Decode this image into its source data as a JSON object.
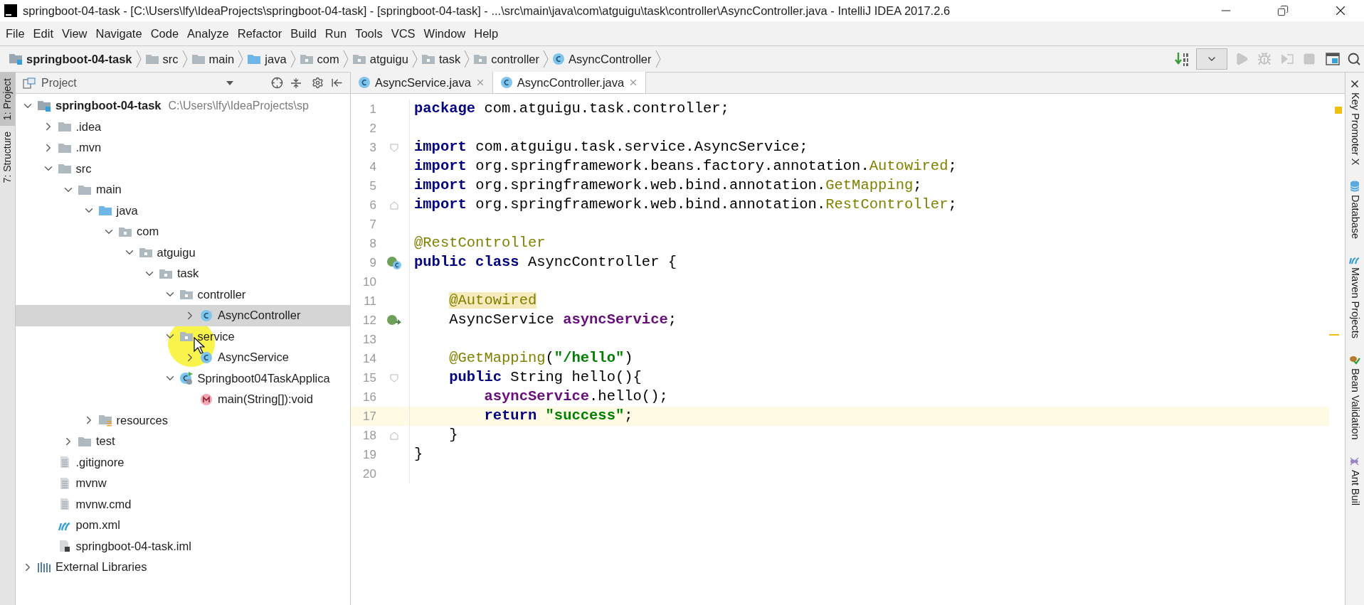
{
  "window": {
    "title": "springboot-04-task - [C:\\Users\\lfy\\IdeaProjects\\springboot-04-task] - [springboot-04-task] - ...\\src\\main\\java\\com\\atguigu\\task\\controller\\AsyncController.java - IntelliJ IDEA 2017.2.6"
  },
  "menu": [
    "File",
    "Edit",
    "View",
    "Navigate",
    "Code",
    "Analyze",
    "Refactor",
    "Build",
    "Run",
    "Tools",
    "VCS",
    "Window",
    "Help"
  ],
  "breadcrumbs": [
    {
      "label": "springboot-04-task",
      "kind": "module"
    },
    {
      "label": "src",
      "kind": "folder"
    },
    {
      "label": "main",
      "kind": "folder"
    },
    {
      "label": "java",
      "kind": "source-root"
    },
    {
      "label": "com",
      "kind": "package"
    },
    {
      "label": "atguigu",
      "kind": "package"
    },
    {
      "label": "task",
      "kind": "package"
    },
    {
      "label": "controller",
      "kind": "package"
    },
    {
      "label": "AsyncController",
      "kind": "class"
    }
  ],
  "left_tool_tabs": [
    {
      "label": "1: Project",
      "selected": true
    },
    {
      "label": "7: Structure",
      "selected": false
    }
  ],
  "project_panel": {
    "title": "Project"
  },
  "tree": [
    {
      "label": "springboot-04-task",
      "kind": "module",
      "path": "C:\\Users\\lfy\\IdeaProjects\\sp",
      "expanded": true,
      "selected": false,
      "children": [
        {
          "label": ".idea",
          "kind": "folder",
          "expanded": false,
          "selected": false
        },
        {
          "label": ".mvn",
          "kind": "folder",
          "expanded": false,
          "selected": false
        },
        {
          "label": "src",
          "kind": "folder",
          "expanded": true,
          "selected": false,
          "children": [
            {
              "label": "main",
              "kind": "folder",
              "expanded": true,
              "selected": false,
              "children": [
                {
                  "label": "java",
                  "kind": "source-root",
                  "expanded": true,
                  "selected": false,
                  "children": [
                    {
                      "label": "com",
                      "kind": "package",
                      "expanded": true,
                      "selected": false,
                      "children": [
                        {
                          "label": "atguigu",
                          "kind": "package",
                          "expanded": true,
                          "selected": false,
                          "children": [
                            {
                              "label": "task",
                              "kind": "package",
                              "expanded": true,
                              "selected": false,
                              "children": [
                                {
                                  "label": "controller",
                                  "kind": "package",
                                  "expanded": true,
                                  "selected": false,
                                  "children": [
                                    {
                                      "label": "AsyncController",
                                      "kind": "class",
                                      "expanded": false,
                                      "selected": true
                                    }
                                  ]
                                },
                                {
                                  "label": "service",
                                  "kind": "package",
                                  "expanded": true,
                                  "selected": false,
                                  "children": [
                                    {
                                      "label": "AsyncService",
                                      "kind": "class",
                                      "expanded": false,
                                      "selected": false
                                    }
                                  ]
                                },
                                {
                                  "label": "Springboot04TaskApplica",
                                  "kind": "app-class",
                                  "expanded": true,
                                  "selected": false,
                                  "children": [
                                    {
                                      "label": "main(String[]):void",
                                      "kind": "method",
                                      "selected": false
                                    }
                                  ]
                                }
                              ]
                            }
                          ]
                        }
                      ]
                    }
                  ]
                },
                {
                  "label": "resources",
                  "kind": "resources",
                  "expanded": false,
                  "selected": false
                }
              ]
            },
            {
              "label": "test",
              "kind": "folder",
              "expanded": false,
              "selected": false
            }
          ]
        },
        {
          "label": ".gitignore",
          "kind": "file",
          "selected": false
        },
        {
          "label": "mvnw",
          "kind": "file",
          "selected": false
        },
        {
          "label": "mvnw.cmd",
          "kind": "file",
          "selected": false
        },
        {
          "label": "pom.xml",
          "kind": "maven",
          "selected": false
        },
        {
          "label": "springboot-04-task.iml",
          "kind": "iml",
          "selected": false
        }
      ]
    },
    {
      "label": "External Libraries",
      "kind": "libraries",
      "expanded": false,
      "selected": false
    }
  ],
  "editor_tabs": [
    {
      "label": "AsyncService.java",
      "selected": false
    },
    {
      "label": "AsyncController.java",
      "selected": true
    }
  ],
  "code": [
    {
      "number": "1",
      "current": false,
      "kind": "plain",
      "tokens": [
        {
          "text": "package ",
          "kind": "kw"
        },
        {
          "text": "com.atguigu.task.controller;",
          "kind": "plain"
        }
      ]
    },
    {
      "number": "2",
      "current": false,
      "kind": "plain"
    },
    {
      "number": "3",
      "current": false,
      "kind": "fold-start",
      "tokens": [
        {
          "text": "import ",
          "kind": "kw"
        },
        {
          "text": "com.atguigu.task.service.AsyncService;",
          "kind": "plain"
        }
      ]
    },
    {
      "number": "4",
      "current": false,
      "kind": "plain",
      "tokens": [
        {
          "text": "import ",
          "kind": "kw"
        },
        {
          "text": "org.springframework.beans.factory.annotation.",
          "kind": "plain"
        },
        {
          "text": "Autowired",
          "kind": "ann"
        },
        {
          "text": ";",
          "kind": "plain"
        }
      ]
    },
    {
      "number": "5",
      "current": false,
      "kind": "plain",
      "tokens": [
        {
          "text": "import ",
          "kind": "kw"
        },
        {
          "text": "org.springframework.web.bind.annotation.",
          "kind": "plain"
        },
        {
          "text": "GetMapping",
          "kind": "ann"
        },
        {
          "text": ";",
          "kind": "plain"
        }
      ]
    },
    {
      "number": "6",
      "current": false,
      "kind": "fold-end",
      "tokens": [
        {
          "text": "import ",
          "kind": "kw"
        },
        {
          "text": "org.springframework.web.bind.annotation.",
          "kind": "plain"
        },
        {
          "text": "RestController",
          "kind": "ann"
        },
        {
          "text": ";",
          "kind": "plain"
        }
      ]
    },
    {
      "number": "7",
      "current": false,
      "kind": "plain"
    },
    {
      "number": "8",
      "current": false,
      "kind": "plain",
      "tokens": [
        {
          "text": "@RestController",
          "kind": "ann"
        }
      ]
    },
    {
      "number": "9",
      "current": false,
      "kind": "class",
      "tokens": [
        {
          "text": "public class ",
          "kind": "kw"
        },
        {
          "text": "AsyncController {",
          "kind": "plain"
        }
      ]
    },
    {
      "number": "10",
      "current": false,
      "kind": "plain"
    },
    {
      "number": "11",
      "current": false,
      "kind": "plain",
      "tokens": [
        {
          "text": "    @Autowired",
          "kind": "ann-hl"
        }
      ]
    },
    {
      "number": "12",
      "current": false,
      "kind": "bean",
      "tokens": [
        {
          "text": "    AsyncService ",
          "kind": "plain"
        },
        {
          "text": "asyncService",
          "kind": "field"
        },
        {
          "text": ";",
          "kind": "plain"
        }
      ]
    },
    {
      "number": "13",
      "current": false,
      "kind": "plain"
    },
    {
      "number": "14",
      "current": false,
      "kind": "plain",
      "tokens": [
        {
          "text": "    @GetMapping",
          "kind": "ann"
        },
        {
          "text": "(",
          "kind": "plain"
        },
        {
          "text": "\"/hello\"",
          "kind": "str"
        },
        {
          "text": ")",
          "kind": "plain"
        }
      ]
    },
    {
      "number": "15",
      "current": false,
      "kind": "fold-start",
      "tokens": [
        {
          "text": "    public ",
          "kind": "kw"
        },
        {
          "text": "String hello(){",
          "kind": "plain"
        }
      ]
    },
    {
      "number": "16",
      "current": false,
      "kind": "plain",
      "tokens": [
        {
          "text": "        asyncService",
          "kind": "field"
        },
        {
          "text": ".hello();",
          "kind": "plain"
        }
      ]
    },
    {
      "number": "17",
      "current": true,
      "kind": "plain",
      "tokens": [
        {
          "text": "        return ",
          "kind": "kw"
        },
        {
          "text": "\"success\"",
          "kind": "str"
        },
        {
          "text": ";",
          "kind": "plain"
        }
      ]
    },
    {
      "number": "18",
      "current": false,
      "kind": "fold-end",
      "tokens": [
        {
          "text": "    }",
          "kind": "plain"
        }
      ]
    },
    {
      "number": "19",
      "current": false,
      "kind": "plain",
      "tokens": [
        {
          "text": "}",
          "kind": "plain"
        }
      ]
    },
    {
      "number": "20",
      "current": false,
      "kind": "plain"
    }
  ],
  "right_tool_tabs": [
    {
      "label": "Key Promoter X",
      "kind": "keypromoter"
    },
    {
      "label": "Database",
      "kind": "database"
    },
    {
      "label": "Maven Projects",
      "kind": "maven"
    },
    {
      "label": "Bean Validation",
      "kind": "bean"
    },
    {
      "label": "Ant Buil",
      "kind": "ant"
    }
  ]
}
